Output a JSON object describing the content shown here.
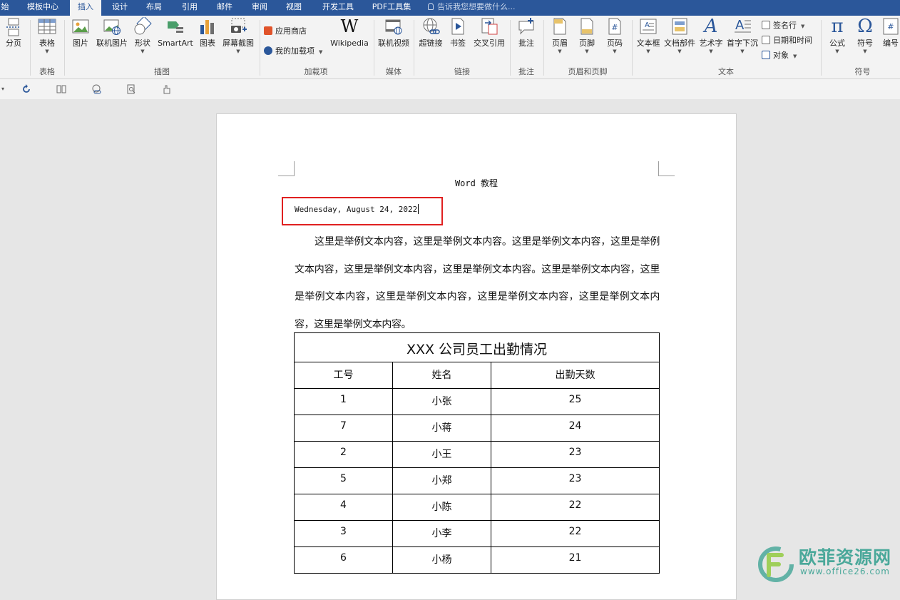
{
  "tabs": [
    {
      "label": "始",
      "active": false
    },
    {
      "label": "模板中心",
      "active": false
    },
    {
      "label": "插入",
      "active": true
    },
    {
      "label": "设计",
      "active": false
    },
    {
      "label": "布局",
      "active": false
    },
    {
      "label": "引用",
      "active": false
    },
    {
      "label": "邮件",
      "active": false
    },
    {
      "label": "审阅",
      "active": false
    },
    {
      "label": "视图",
      "active": false
    },
    {
      "label": "开发工具",
      "active": false
    },
    {
      "label": "PDF工具集",
      "active": false
    }
  ],
  "tell_me": "告诉我您想要做什么...",
  "ribbon": {
    "page_break": "分页",
    "table": "表格",
    "picture": "图片",
    "online_picture": "联机图片",
    "shapes": "形状",
    "smartart": "SmartArt",
    "chart": "图表",
    "screenshot": "屏幕截图",
    "app_store": "应用商店",
    "my_addins": "我的加载项",
    "wikipedia": "Wikipedia",
    "online_video": "联机视频",
    "hyperlink": "超链接",
    "bookmark": "书签",
    "cross_reference": "交叉引用",
    "comment": "批注",
    "header": "页眉",
    "footer": "页脚",
    "page_number": "页码",
    "text_box": "文本框",
    "quick_parts": "文档部件",
    "wordart": "艺术字",
    "drop_cap": "首字下沉",
    "signature_line": "签名行",
    "date_time": "日期和时间",
    "object": "对象",
    "equation": "公式",
    "symbol": "符号",
    "numbering": "编号",
    "groups": {
      "tables": "表格",
      "illustrations": "插图",
      "addins": "加载项",
      "media": "媒体",
      "links": "链接",
      "comments": "批注",
      "header_footer": "页眉和页脚",
      "text": "文本",
      "symbols": "符号"
    }
  },
  "document": {
    "header_text": "Word 教程",
    "date_text": "Wednesday, August 24, 2022",
    "paragraph": "这里是举例文本内容，这里是举例文本内容。这里是举例文本内容，这里是举例文本内容，这里是举例文本内容，这里是举例文本内容。这里是举例文本内容，这里是举例文本内容，这里是举例文本内容，这里是举例文本内容，这里是举例文本内容，这里是举例文本内容。",
    "table": {
      "title": "XXX 公司员工出勤情况",
      "headers": [
        "工号",
        "姓名",
        "出勤天数"
      ],
      "rows": [
        [
          "1",
          "小张",
          "25"
        ],
        [
          "7",
          "小蒋",
          "24"
        ],
        [
          "2",
          "小王",
          "23"
        ],
        [
          "5",
          "小郑",
          "23"
        ],
        [
          "4",
          "小陈",
          "22"
        ],
        [
          "3",
          "小李",
          "22"
        ],
        [
          "6",
          "小杨",
          "21"
        ]
      ]
    }
  },
  "watermark": {
    "name": "欧菲资源网",
    "url": "www.office26.com"
  },
  "colors": {
    "ribbon_blue": "#2b579a",
    "highlight_red": "#e02020",
    "watermark_green": "#4aa89a"
  }
}
